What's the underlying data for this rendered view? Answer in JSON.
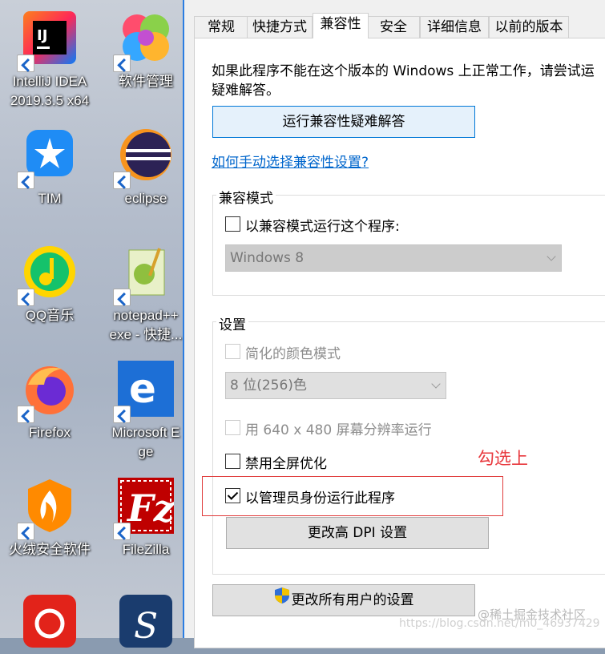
{
  "desktop": {
    "icons": [
      {
        "name": "intellij-idea-icon",
        "label": "IntelliJ IDEA\n2019.3.5 x64"
      },
      {
        "name": "software-manager-icon",
        "label": "软件管理"
      },
      {
        "name": "tim-icon",
        "label": "TIM"
      },
      {
        "name": "eclipse-icon",
        "label": "eclipse"
      },
      {
        "name": "qq-music-icon",
        "label": "QQ音乐"
      },
      {
        "name": "notepadpp-icon",
        "label": "notepad++\nexe - 快捷..."
      },
      {
        "name": "firefox-icon",
        "label": "Firefox"
      },
      {
        "name": "edge-icon",
        "label": "Microsoft E\nge"
      },
      {
        "name": "huorong-icon",
        "label": "火绒安全软件"
      },
      {
        "name": "filezilla-icon",
        "label": "FileZilla"
      }
    ]
  },
  "dialog": {
    "tabs": [
      "常规",
      "快捷方式",
      "兼容性",
      "安全",
      "详细信息",
      "以前的版本"
    ],
    "intro_line1": "如果此程序不能在这个版本的 Windows 上正常工作，请尝试运",
    "intro_line2": "疑难解答。",
    "troubleshoot_button": "运行兼容性疑难解答",
    "manual_link": "如何手动选择兼容性设置?",
    "compat_group": {
      "title": "兼容模式",
      "checkbox_label": "以兼容模式运行这个程序:",
      "os_select": "Windows 8"
    },
    "settings_group": {
      "title": "设置",
      "reduced_color_label": "简化的颜色模式",
      "color_select": "8 位(256)色",
      "res_640_label": "用 640 x 480 屏幕分辨率运行",
      "disable_fullscreen_label": "禁用全屏优化",
      "run_as_admin_label": "以管理员身份运行此程序",
      "dpi_button": "更改高 DPI 设置"
    },
    "all_users_button": "更改所有用户的设置"
  },
  "annotation": {
    "text": "勾选上"
  },
  "watermark": {
    "line1": "@稀土掘金技术社区",
    "line2": "https://blog.csdn.net/m0_46937429"
  },
  "colors": {
    "accent": "#0078d7",
    "annotation": "#e8383d"
  }
}
